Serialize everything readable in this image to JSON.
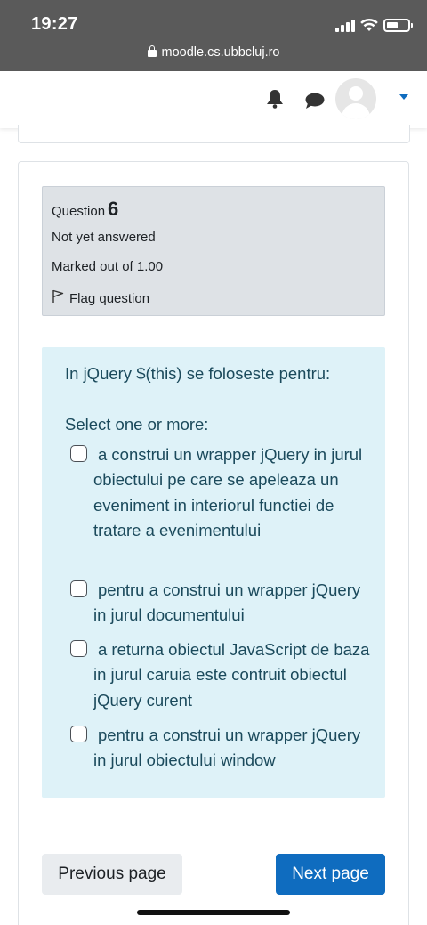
{
  "status_bar": {
    "time": "19:27",
    "url": "moodle.cs.ubbcluj.ro"
  },
  "navbar": {
    "icons": [
      "bell-icon",
      "chat-icon",
      "avatar",
      "caret-down-icon"
    ],
    "accent_color": "#0f6cbf"
  },
  "question": {
    "label": "Question",
    "number": "6",
    "state": "Not yet answered",
    "grade": "Marked out of 1.00",
    "flag_label": "Flag question"
  },
  "formulation": {
    "text": "In jQuery $(this) se foloseste pentru:",
    "prompt": "Select one or more:",
    "answers": [
      {
        "label": "a construi un wrapper jQuery in jurul obiectului pe care se apeleaza un eveniment in interiorul functiei de tratare a evenimentului",
        "checked": false
      },
      {
        "label": "pentru a construi un wrapper jQuery in jurul documentului",
        "checked": false
      },
      {
        "label": "a returna obiectul JavaScript de baza in jurul caruia este contruit obiectul jQuery curent",
        "checked": false
      },
      {
        "label": "pentru a construi un wrapper jQuery in jurul obiectului window",
        "checked": false
      }
    ]
  },
  "navigation": {
    "previous_label": "Previous page",
    "next_label": "Next page"
  }
}
